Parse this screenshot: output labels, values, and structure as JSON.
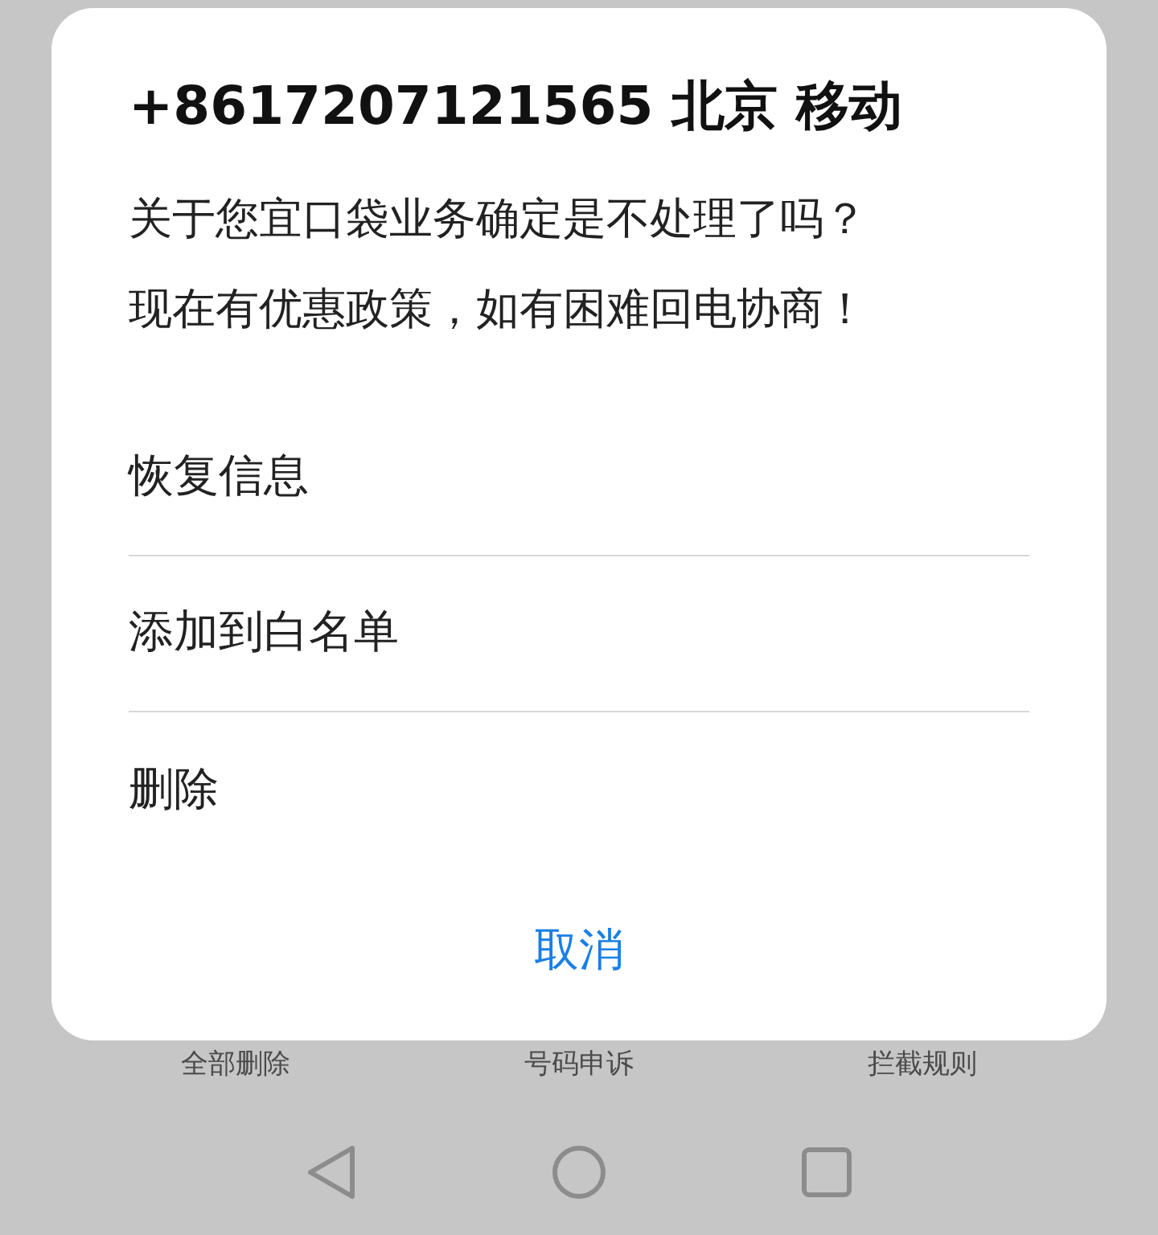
{
  "background": {
    "toolbar": [
      "全部删除",
      "号码申诉",
      "拦截规则"
    ]
  },
  "dialog": {
    "title": "+8617207121565 北京 移动",
    "message": [
      "关于您宜口袋业务确定是不处理了吗？",
      "现在有优惠政策，如有困难回电协商！"
    ],
    "options": [
      "恢复信息",
      "添加到白名单",
      "删除"
    ],
    "cancel": "取消"
  },
  "nav_bar": {
    "buttons": [
      {
        "kind": "back"
      },
      {
        "kind": "home"
      },
      {
        "kind": "recents"
      }
    ]
  }
}
